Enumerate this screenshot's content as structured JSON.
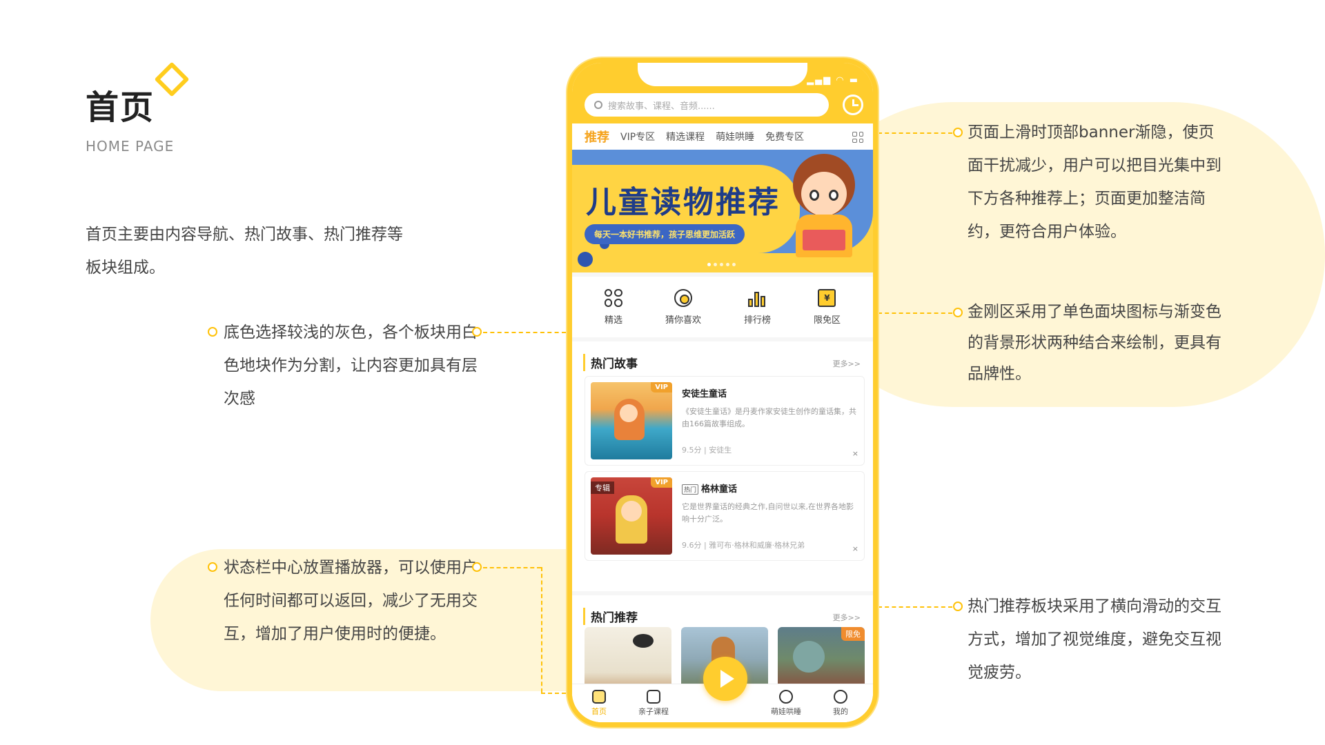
{
  "page": {
    "title": "首页",
    "subtitle": "HOME PAGE",
    "intro": "首页主要由内容导航、热门故事、热门推荐等板块组成。"
  },
  "annotations": {
    "background": "底色选择较浅的灰色，各个板块用白色地块作为分割，让内容更加具有层次感",
    "player": "状态栏中心放置播放器，可以使用户任何时间都可以返回，减少了无用交互，增加了用户使用时的便捷。",
    "banner": "页面上滑时顶部banner渐隐，使页面干扰减少，用户可以把目光集中到下方各种推荐上；页面更加整洁简约，更符合用户体验。",
    "kingkong": "金刚区采用了单色面块图标与渐变色的背景形状两种结合来绘制，更具有品牌性。",
    "recommend": "热门推荐板块采用了横向滑动的交互方式，增加了视觉维度，避免交互视觉疲劳。"
  },
  "app": {
    "search_placeholder": "搜索故事、课程、音频......",
    "tabs": [
      "推荐",
      "VIP专区",
      "精选课程",
      "萌娃哄睡",
      "免费专区"
    ],
    "banner": {
      "headline": "儿童读物推荐",
      "tagline": "每天一本好书推荐，孩子思维更加活跃"
    },
    "kingkong": [
      {
        "label": "精选",
        "icon": "grid-icon"
      },
      {
        "label": "猜你喜欢",
        "icon": "eye-icon"
      },
      {
        "label": "排行榜",
        "icon": "ranking-icon"
      },
      {
        "label": "限免区",
        "icon": "ticket-icon"
      }
    ],
    "hot_stories": {
      "title": "热门故事",
      "more": "更多>>",
      "items": [
        {
          "badge": "VIP",
          "title": "安徒生童话",
          "desc": "《安徒生童话》是丹麦作家安徒生创作的童话集，共由166篇故事组成。",
          "meta": "9.5分  |  安徒生",
          "close": "×"
        },
        {
          "badge": "VIP",
          "tag": "专辑",
          "hot": "热门",
          "title": "格林童话",
          "desc": "它是世界童话的经典之作,自问世以来,在世界各地影响十分广泛。",
          "meta": "9.6分  |  雅可布·格林和威廉·格林兄弟",
          "close": "×"
        }
      ]
    },
    "hot_recs": {
      "title": "热门推荐",
      "more": "更多>>",
      "badge": "限免"
    },
    "tabbar": [
      "首页",
      "亲子课程",
      "萌娃哄睡",
      "我的"
    ],
    "colors": {
      "brand": "#FFCD2E",
      "accent": "#F5A31C",
      "banner_blue": "#5B8FD9"
    }
  }
}
